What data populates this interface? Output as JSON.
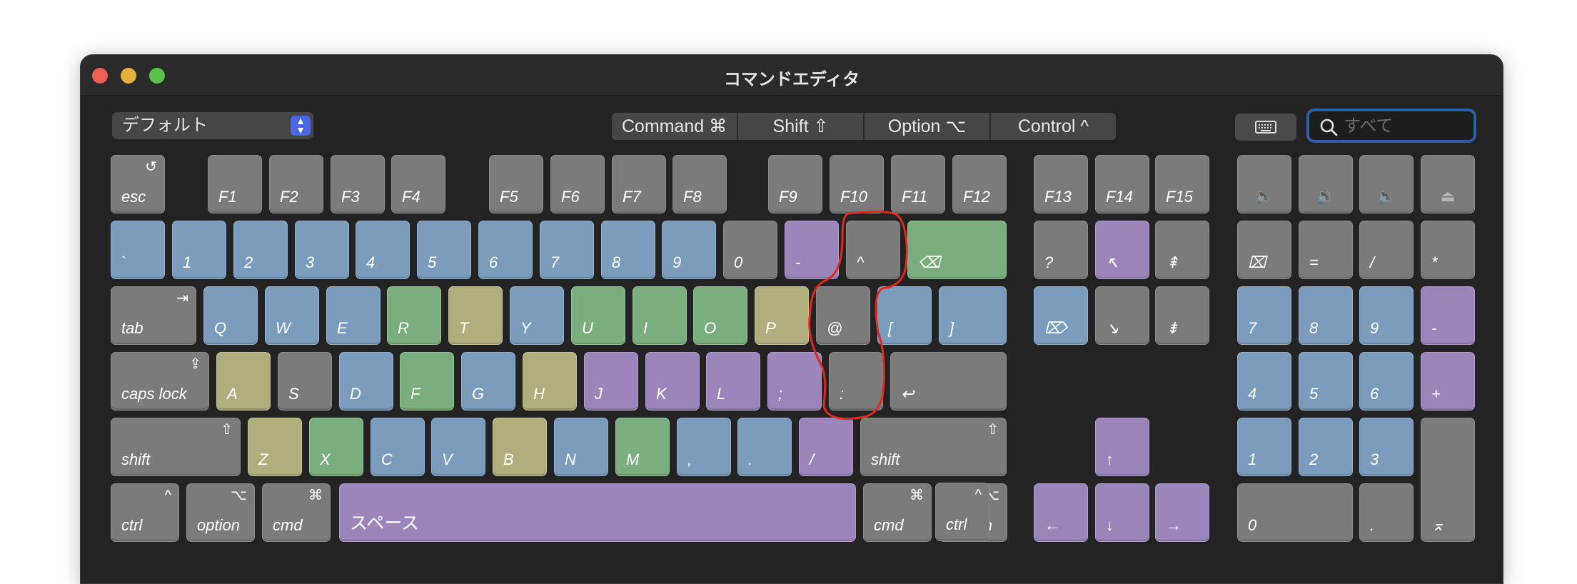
{
  "window": {
    "title": "コマンドエディタ"
  },
  "preset": {
    "value": "デフォルト",
    "stepper": "⌃⌄"
  },
  "modifiers": [
    "Command ⌘",
    "Shift ⇧",
    "Option ⌥",
    "Control ^"
  ],
  "search": {
    "placeholder": "すべて"
  },
  "colors": {
    "gray": "#7b7b7b",
    "blue": "#7b9cbd",
    "purple": "#9b85bb",
    "green": "#7aae7e",
    "yellow": "#b0ae7c",
    "annotation": "#e0281f"
  },
  "icons": {
    "esc": "undo-icon",
    "tab": "tab-arrow-icon",
    "caps": "caps-lock-icon",
    "shift": "shift-icon",
    "option": "option-icon",
    "cmd": "command-icon",
    "ctrl": "control-icon",
    "delete": "delete-icon",
    "forward_delete": "forward-delete-icon",
    "return": "return-icon",
    "clear": "clear-icon",
    "enter": "enter-icon"
  },
  "keys": {
    "esc": "esc",
    "f1": "F1",
    "f2": "F2",
    "f3": "F3",
    "f4": "F4",
    "f5": "F5",
    "f6": "F6",
    "f7": "F7",
    "f8": "F8",
    "f9": "F9",
    "f10": "F10",
    "f11": "F11",
    "f12": "F12",
    "f13": "F13",
    "f14": "F14",
    "f15": "F15",
    "backtick": "`",
    "k1": "1",
    "k2": "2",
    "k3": "3",
    "k4": "4",
    "k5": "5",
    "k6": "6",
    "k7": "7",
    "k8": "8",
    "k9": "9",
    "k0": "0",
    "minus": "-",
    "caret": "^",
    "yen": "",
    "help": "?",
    "home": "↖",
    "pageup": "⇞",
    "tab": "tab",
    "q": "Q",
    "w": "W",
    "e": "E",
    "r": "R",
    "t": "T",
    "y": "Y",
    "u": "U",
    "i": "I",
    "o": "O",
    "p": "P",
    "at": "@",
    "lbracket": "[",
    "rbracket": "]",
    "end": "↘",
    "pagedown": "⇟",
    "caps": "caps lock",
    "a": "A",
    "s": "S",
    "d": "D",
    "f": "F",
    "g": "G",
    "h": "H",
    "j": "J",
    "k": "K",
    "l": "L",
    "semicolon": ";",
    "colon": ":",
    "lshift": "shift",
    "z": "Z",
    "x": "X",
    "c": "C",
    "v": "V",
    "b": "B",
    "n": "N",
    "m": "M",
    "comma": ",",
    "period": ".",
    "slash": "/",
    "rshift": "shift",
    "up": "↑",
    "lctrl": "ctrl",
    "loption": "option",
    "lcmd": "cmd",
    "space": "スペース",
    "rcmd": "cmd",
    "roption": "option",
    "rctrl": "ctrl",
    "left": "←",
    "down": "↓",
    "right": "→",
    "vol_mute": "🔈",
    "vol_down": "🔉",
    "vol_up": "🔈",
    "eject": "⏏",
    "np_equal": "=",
    "np_divide": "/",
    "np_multiply": "*",
    "np7": "7",
    "np8": "8",
    "np9": "9",
    "np_minus": "-",
    "np4": "4",
    "np5": "5",
    "np6": "6",
    "np_plus": "+",
    "np1": "1",
    "np2": "2",
    "np3": "3",
    "np0": "0",
    "np_dot": ".",
    "np_enter": "⌅"
  }
}
